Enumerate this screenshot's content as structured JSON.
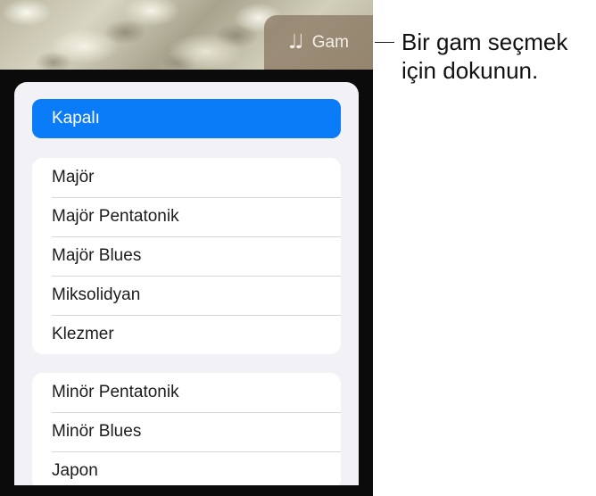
{
  "toolbar": {
    "scale_button_icon": "♩♩",
    "scale_button_icon_name": "musical-notes-icon",
    "scale_button_label": "Gam"
  },
  "scale_menu": {
    "selected_label": "Kapalı",
    "accent_color": "#0a7cf8",
    "group_major": [
      "Majör",
      "Majör Pentatonik",
      "Majör Blues",
      "Miksolidyan",
      "Klezmer"
    ],
    "group_minor": [
      "Minör Pentatonik",
      "Minör Blues",
      "Japon"
    ]
  },
  "callout": {
    "line1": "Bir gam seçmek",
    "line2": "için dokunun."
  }
}
